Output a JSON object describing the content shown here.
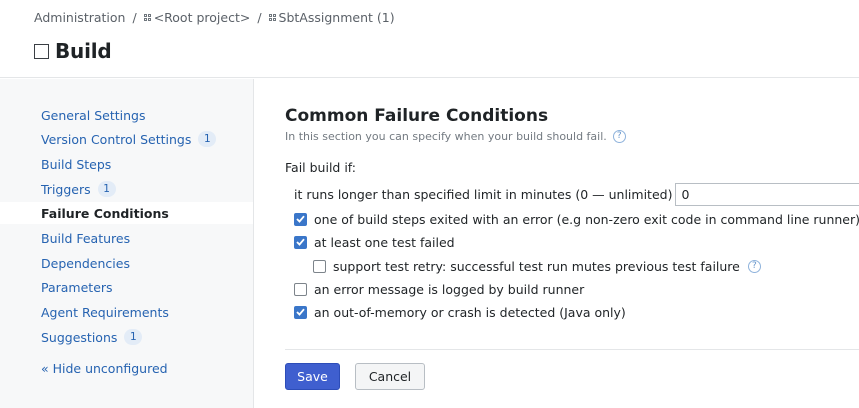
{
  "breadcrumb": {
    "items": [
      "Administration",
      "<Root project>",
      "SbtAssignment (1)"
    ],
    "separator": "/"
  },
  "header": {
    "title": "Build"
  },
  "sidebar": {
    "items": [
      {
        "label": "General Settings",
        "badge": ""
      },
      {
        "label": "Version Control Settings",
        "badge": "1"
      },
      {
        "label": "Build Steps",
        "badge": ""
      },
      {
        "label": "Triggers",
        "badge": "1"
      },
      {
        "label": "Failure Conditions",
        "badge": "",
        "active": true
      },
      {
        "label": "Build Features",
        "badge": ""
      },
      {
        "label": "Dependencies",
        "badge": ""
      },
      {
        "label": "Parameters",
        "badge": ""
      },
      {
        "label": "Agent Requirements",
        "badge": ""
      },
      {
        "label": "Suggestions",
        "badge": "1"
      }
    ],
    "hide_link": "« Hide unconfigured"
  },
  "main": {
    "section_title": "Common Failure Conditions",
    "section_description": "In this section you can specify when your build should fail.",
    "fail_build_label": "Fail build if:",
    "time_limit": {
      "label": "it runs longer than specified limit in minutes (0 — unlimited)",
      "value": "0"
    },
    "conditions": [
      {
        "label": "one of build steps exited with an error (e.g non-zero exit code in command line runner)",
        "checked": true
      },
      {
        "label": "at least one test failed",
        "checked": true
      },
      {
        "label": "support test retry: successful test run mutes previous test failure",
        "checked": false
      },
      {
        "label": "an error message is logged by build runner",
        "checked": false
      },
      {
        "label": "an out-of-memory or crash is detected (Java only)",
        "checked": true
      }
    ]
  },
  "actions": {
    "save": "Save",
    "cancel": "Cancel"
  },
  "colors": {
    "accent": "#3f5fcf",
    "link": "#2663b1",
    "checkbox": "#3a76c9"
  }
}
